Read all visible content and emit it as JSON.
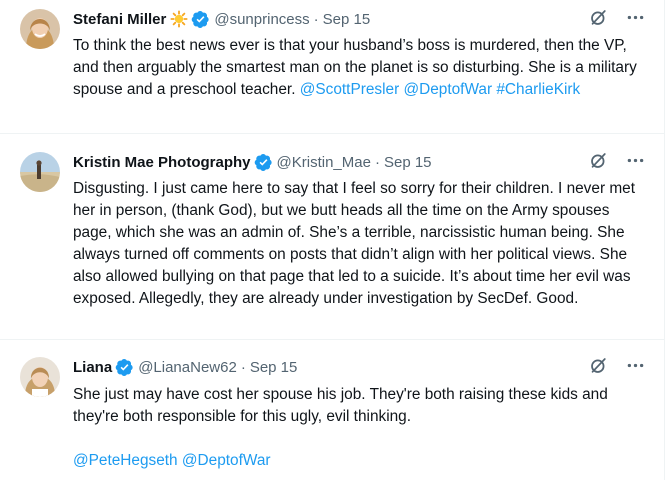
{
  "tweets": [
    {
      "name": "Stefani Miller",
      "handle": "@sunprincess",
      "sep": "·",
      "date": "Sep 15",
      "text": "To think the best news ever is that your husband’s boss is murdered, then the VP, and then arguably the smartest man on the planet is so disturbing. She is a military spouse and a preschool teacher.",
      "mentions": [
        "@ScottPresler",
        "@DeptofWar",
        "#CharlieKirk"
      ]
    },
    {
      "name": "Kristin Mae Photography",
      "handle": "@Kristin_Mae",
      "sep": "·",
      "date": "Sep 15",
      "text": "Disgusting. I just came here to say that I feel so sorry for their children. I never met her in person, (thank God), but we butt heads all the time on the Army spouses page, which she was an admin of. She’s a terrible, narcissistic human being. She always turned off comments on posts that didn’t align with her political views. She also allowed bullying on that page that led to a suicide. It’s about time her evil was exposed. Allegedly, they are already under investigation by SecDef. Good."
    },
    {
      "name": "Liana",
      "handle": "@LianaNew62",
      "sep": "·",
      "date": "Sep 15",
      "text": "She just may have cost her spouse his job. They're both raising these kids and they're both responsible for this ugly, evil thinking.",
      "mentions": [
        "@PeteHegseth",
        "@DeptofWar"
      ]
    }
  ],
  "icons": {
    "verified": "verified-badge-icon",
    "sun": "sun-emoji-icon",
    "grok": "grok-icon",
    "more": "more-options-icon"
  },
  "colors": {
    "text": "#0f1419",
    "secondary": "#536471",
    "link": "#1d9bf0",
    "verified": "#1d9bf0",
    "divider": "#eff3f4"
  }
}
